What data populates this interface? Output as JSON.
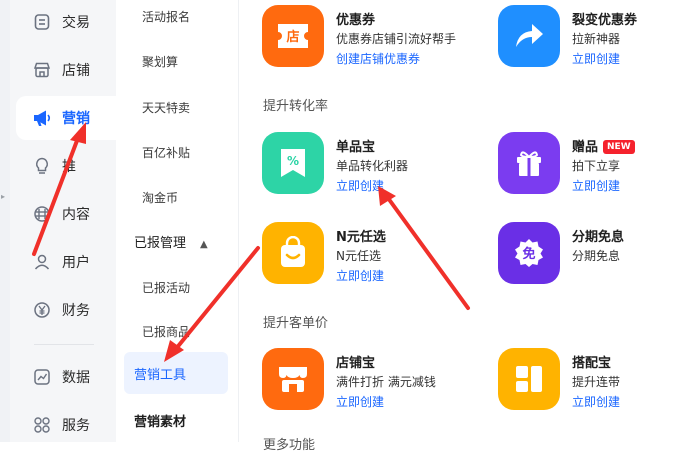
{
  "primary_nav": {
    "items": [
      {
        "label": "交易",
        "icon": "ledger-icon"
      },
      {
        "label": "店铺",
        "icon": "store-icon"
      },
      {
        "label": "营销",
        "icon": "megaphone-icon",
        "active": true
      },
      {
        "label": "推",
        "icon": "lightbulb-icon"
      },
      {
        "label": "内容",
        "icon": "content-icon"
      },
      {
        "label": "用户",
        "icon": "user-icon"
      },
      {
        "label": "财务",
        "icon": "yuan-icon"
      },
      {
        "label": "数据",
        "icon": "chart-icon"
      },
      {
        "label": "服务",
        "icon": "grid-icon"
      }
    ]
  },
  "secondary_nav": {
    "items_top": [
      "活动报名",
      "聚划算",
      "天天特卖",
      "百亿补贴",
      "淘金币"
    ],
    "group_label": "已报管理",
    "group_items": [
      "已报活动",
      "已报商品"
    ],
    "active_item": "营销工具",
    "next_item": "营销素材"
  },
  "content": {
    "section_conversion": "提升转化率",
    "section_order_value": "提升客单价",
    "tools": [
      {
        "name": "优惠券",
        "desc": "优惠券店铺引流好帮手",
        "link": "创建店铺优惠券",
        "tile_glyph": "店",
        "color": "#ff6a0f"
      },
      {
        "name": "裂变优惠券",
        "desc": "拉新神器",
        "link": "立即创建",
        "color": "#1f8fff"
      },
      {
        "name": "单品宝",
        "desc": "单品转化利器",
        "link": "立即创建",
        "tile_glyph": "%",
        "color": "#2dd4a6"
      },
      {
        "name": "赠品",
        "badge": "NEW",
        "desc": "拍下立享",
        "link": "立即创建",
        "color": "#7b3cf0"
      },
      {
        "name": "N元任选",
        "desc": "N元任选",
        "link": "立即创建",
        "color": "#ffb300"
      },
      {
        "name": "分期免息",
        "desc": "分期免息",
        "link": "",
        "tile_glyph": "免",
        "color": "#6a2fe6"
      },
      {
        "name": "店铺宝",
        "desc": "满件打折 满元减钱",
        "link": "立即创建",
        "color": "#ff6a0f"
      },
      {
        "name": "搭配宝",
        "desc": "提升连带",
        "link": "立即创建",
        "color": "#ffb300"
      }
    ],
    "cut_off_heading": "更多功能"
  },
  "colors": {
    "accent": "#1a66ff",
    "annotation_red": "#f0302a"
  }
}
